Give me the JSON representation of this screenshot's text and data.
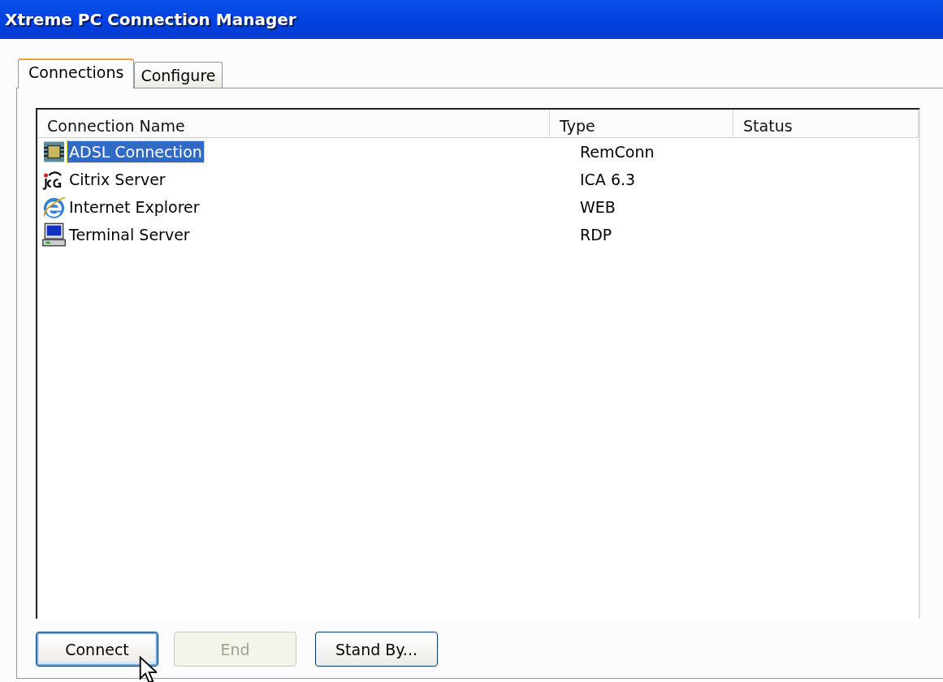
{
  "window": {
    "title": "Xtreme PC Connection Manager"
  },
  "tabs": [
    {
      "label": "Connections",
      "selected": true
    },
    {
      "label": "Configure",
      "selected": false
    }
  ],
  "table": {
    "columns": [
      "Connection Name",
      "Type",
      "Status"
    ],
    "rows": [
      {
        "kind": "network",
        "name": "ADSL Connection",
        "type": "RemConn",
        "selected": true
      },
      {
        "kind": "ica",
        "name": "Citrix Server",
        "type": "ICA 6.3",
        "selected": false
      },
      {
        "kind": "browser",
        "name": "Internet Explorer",
        "type": "WEB",
        "selected": false
      },
      {
        "kind": "computer",
        "name": "Terminal Server",
        "type": "RDP",
        "selected": false
      }
    ]
  },
  "buttons": [
    {
      "label": "Connect",
      "disabled": false,
      "focused": true
    },
    {
      "label": "End",
      "disabled": true,
      "focused": false
    },
    {
      "label": "Stand By...",
      "disabled": false,
      "focused": false
    }
  ]
}
